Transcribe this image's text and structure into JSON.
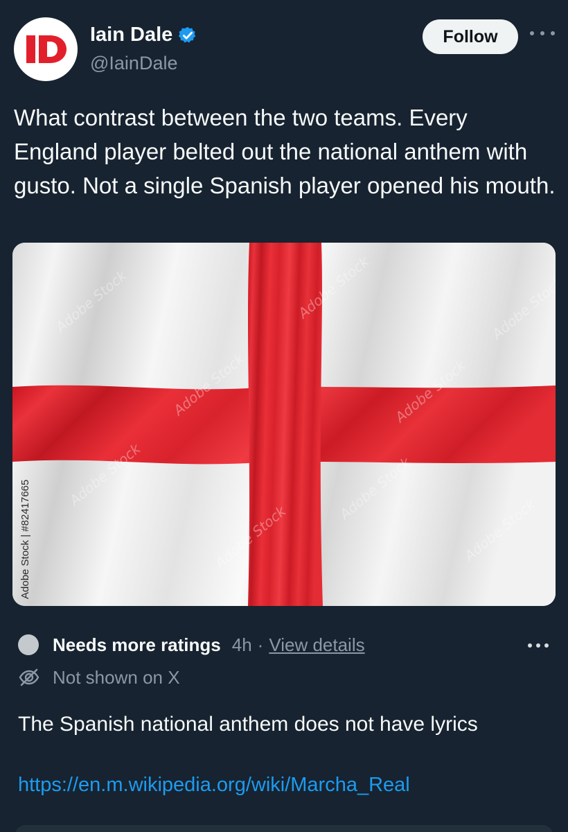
{
  "author": {
    "display_name": "Iain Dale",
    "handle": "@IainDale",
    "avatar_text": "ID",
    "verified": true
  },
  "header": {
    "follow_label": "Follow",
    "more_icon": "more-horizontal-icon"
  },
  "tweet": {
    "text": "What contrast between the two teams. Every England player belted out the national anthem with gusto. Not a single Spanish player opened his mouth."
  },
  "media": {
    "description_icon": "england-flag-image",
    "stock_label": "Adobe Stock | #82417665",
    "watermark": "Adobe Stock"
  },
  "community_note": {
    "status": "Needs more ratings",
    "time": "4h",
    "separator": "·",
    "details_link": "View details",
    "visibility": "Not shown on X",
    "body": "The Spanish national anthem does not have lyrics",
    "url": "https://en.m.wikipedia.org/wiki/Marcha_Real"
  },
  "colors": {
    "background": "#172330",
    "accent_link": "#1d9bf0",
    "verified": "#1d9bf0",
    "flag_red": "#e3222e",
    "muted_text": "#8b98a5"
  }
}
